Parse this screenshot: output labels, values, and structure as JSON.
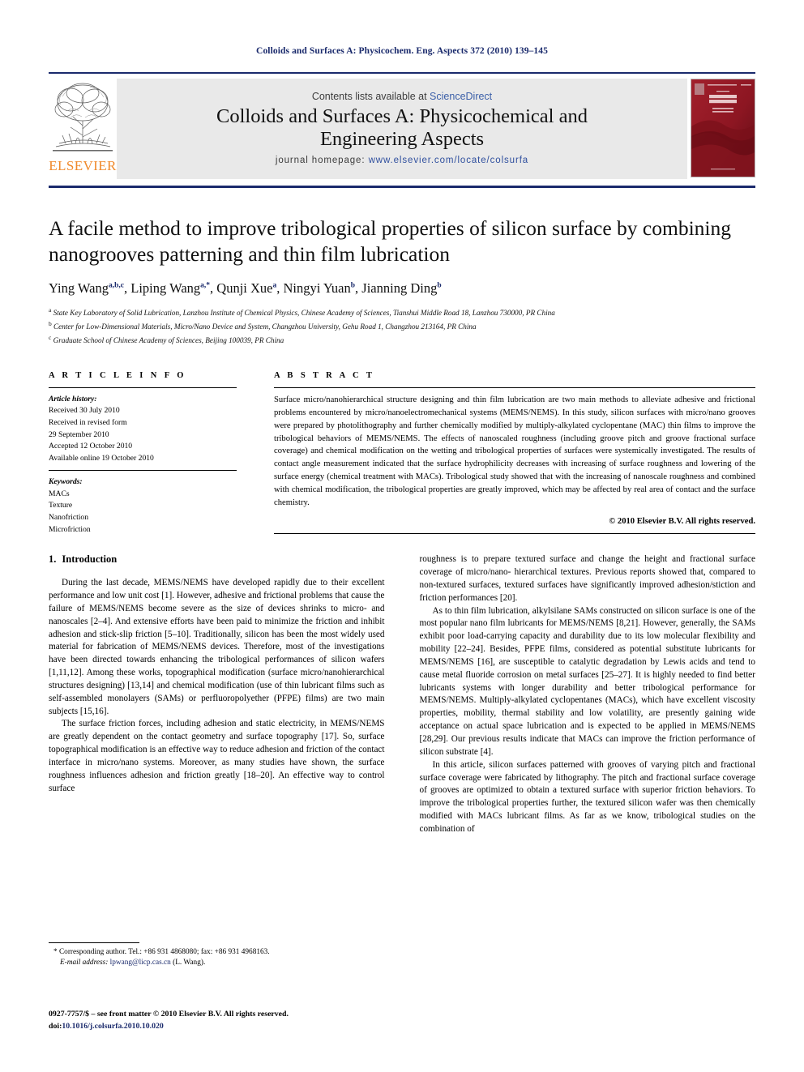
{
  "running_head": "Colloids and Surfaces A: Physicochem. Eng. Aspects 372 (2010) 139–145",
  "masthead": {
    "publisher_wordmark": "ELSEVIER",
    "contents_prefix": "Contents lists available at ",
    "contents_link": "ScienceDirect",
    "journal_title_line1": "Colloids and Surfaces A: Physicochemical and",
    "journal_title_line2": "Engineering Aspects",
    "homepage_label": "journal homepage:",
    "homepage_url": "www.elsevier.com/locate/colsurfa",
    "cover_title_line1": "COLLOIDS AND",
    "cover_title_line2": "SURFACES A",
    "cover_sub_line1": "Physicochemical and",
    "cover_sub_line2": "Engineering Aspects"
  },
  "article": {
    "title": "A facile method to improve tribological properties of silicon surface by combining nanogrooves patterning and thin film lubrication",
    "authors": [
      {
        "name": "Ying Wang",
        "sup": "a,b,c",
        "sep": ", "
      },
      {
        "name": "Liping Wang",
        "sup": "a,*",
        "sep": ", "
      },
      {
        "name": "Qunji Xue",
        "sup": "a",
        "sep": ", "
      },
      {
        "name": "Ningyi Yuan",
        "sup": "b",
        "sep": ", "
      },
      {
        "name": "Jianning Ding",
        "sup": "b",
        "sep": ""
      }
    ],
    "affiliations": [
      {
        "mark": "a",
        "text": "State Key Laboratory of Solid Lubrication, Lanzhou Institute of Chemical Physics, Chinese Academy of Sciences, Tianshui Middle Road 18, Lanzhou 730000, PR China"
      },
      {
        "mark": "b",
        "text": "Center for Low-Dimensional Materials, Micro/Nano Device and System, Changzhou University, Gehu Road 1, Changzhou 213164, PR China"
      },
      {
        "mark": "c",
        "text": "Graduate School of Chinese Academy of Sciences, Beijing 100039, PR China"
      }
    ]
  },
  "article_info": {
    "heading": "A R T I C L E   I N F O",
    "history_label": "Article history:",
    "history": [
      "Received 30 July 2010",
      "Received in revised form",
      "29 September 2010",
      "Accepted 12 October 2010",
      "Available online 19 October 2010"
    ],
    "keywords_label": "Keywords:",
    "keywords": [
      "MACs",
      "Texture",
      "Nanofriction",
      "Microfriction"
    ]
  },
  "abstract": {
    "heading": "A B S T R A C T",
    "text": "Surface micro/nanohierarchical structure designing and thin film lubrication are two main methods to alleviate adhesive and frictional problems encountered by micro/nanoelectromechanical systems (MEMS/NEMS). In this study, silicon surfaces with micro/nano grooves were prepared by photolithography and further chemically modified by multiply-alkylated cyclopentane (MAC) thin films to improve the tribological behaviors of MEMS/NEMS. The effects of nanoscaled roughness (including groove pitch and groove fractional surface coverage) and chemical modification on the wetting and tribological properties of surfaces were systemically investigated. The results of contact angle measurement indicated that the surface hydrophilicity decreases with increasing of surface roughness and lowering of the surface energy (chemical treatment with MACs). Tribological study showed that with the increasing of nanoscale roughness and combined with chemical modification, the tribological properties are greatly improved, which may be affected by real area of contact and the surface chemistry.",
    "copyright": "© 2010 Elsevier B.V. All rights reserved."
  },
  "introduction": {
    "number": "1.",
    "heading": "Introduction",
    "left_paragraphs": [
      "During the last decade, MEMS/NEMS have developed rapidly due to their excellent performance and low unit cost [1]. However, adhesive and frictional problems that cause the failure of MEMS/NEMS become severe as the size of devices shrinks to micro- and nanoscales [2–4]. And extensive efforts have been paid to minimize the friction and inhibit adhesion and stick-slip friction [5–10]. Traditionally, silicon has been the most widely used material for fabrication of MEMS/NEMS devices. Therefore, most of the investigations have been directed towards enhancing the tribological performances of silicon wafers [1,11,12]. Among these works, topographical modification (surface micro/nanohierarchical structures designing) [13,14] and chemical modification (use of thin lubricant films such as self-assembled monolayers (SAMs) or perfluoropolyether (PFPE) films) are two main subjects [15,16].",
      "The surface friction forces, including adhesion and static electricity, in MEMS/NEMS are greatly dependent on the contact geometry and surface topography [17]. So, surface topographical modification is an effective way to reduce adhesion and friction of the contact interface in micro/nano systems. Moreover, as many studies have shown, the surface roughness influences adhesion and friction greatly [18–20]. An effective way to control surface"
    ],
    "right_paragraphs": [
      "roughness is to prepare textured surface and change the height and fractional surface coverage of micro/nano- hierarchical textures. Previous reports showed that, compared to non-textured surfaces, textured surfaces have significantly improved adhesion/stiction and friction performances [20].",
      "As to thin film lubrication, alkylsilane SAMs constructed on silicon surface is one of the most popular nano film lubricants for MEMS/NEMS [8,21]. However, generally, the SAMs exhibit poor load-carrying capacity and durability due to its low molecular flexibility and mobility [22–24]. Besides, PFPE films, considered as potential substitute lubricants for MEMS/NEMS [16], are susceptible to catalytic degradation by Lewis acids and tend to cause metal fluoride corrosion on metal surfaces [25–27]. It is highly needed to find better lubricants systems with longer durability and better tribological performance for MEMS/NEMS. Multiply-alkylated cyclopentanes (MACs), which have excellent viscosity properties, mobility, thermal stability and low volatility, are presently gaining wide acceptance on actual space lubrication and is expected to be applied in MEMS/NEMS [28,29]. Our previous results indicate that MACs can improve the friction performance of silicon substrate [4].",
      "In this article, silicon surfaces patterned with grooves of varying pitch and fractional surface coverage were fabricated by lithography. The pitch and fractional surface coverage of grooves are optimized to obtain a textured surface with superior friction behaviors. To improve the tribological properties further, the textured silicon wafer was then chemically modified with MACs lubricant films. As far as we know, tribological studies on the combination of"
    ]
  },
  "footnote": {
    "star": "*",
    "corresponding": "Corresponding author. Tel.: +86 931 4868080; fax: +86 931 4968163.",
    "email_label": "E-mail address:",
    "email": "lpwang@licp.cas.cn",
    "email_owner": "(L. Wang)."
  },
  "footer": {
    "issn_line": "0927-7757/$ – see front matter © 2010 Elsevier B.V. All rights reserved.",
    "doi_label": "doi:",
    "doi_value": "10.1016/j.colsurfa.2010.10.020"
  },
  "colors": {
    "journal_blue": "#1a2a6c",
    "link_blue": "#2f4f9e",
    "elsevier_orange": "#f0892b",
    "banner_grey": "#e9e9e9",
    "cover_red": "#8d1622"
  }
}
